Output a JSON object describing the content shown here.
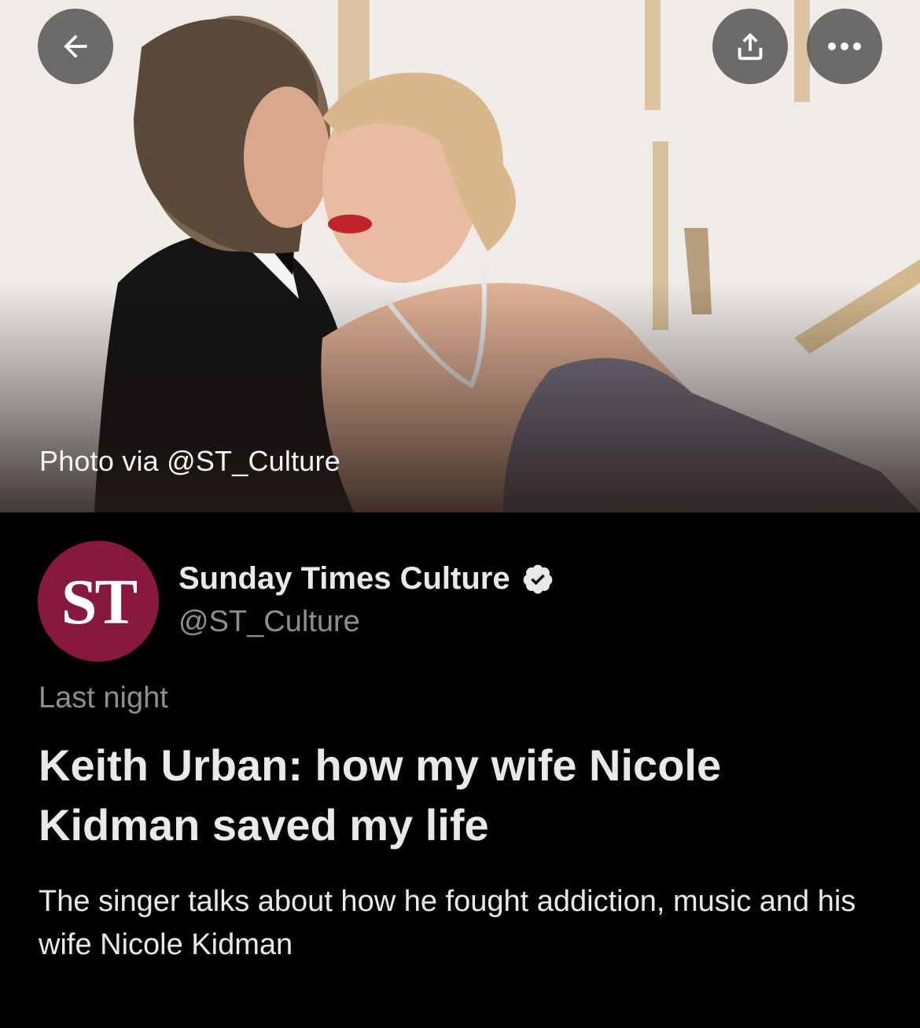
{
  "hero": {
    "image_alt": "Man in tuxedo and woman in strapless gown embracing",
    "photo_credit": "Photo via @ST_Culture"
  },
  "toolbar": {
    "back_icon": "arrow-left-icon",
    "share_icon": "share-upload-icon",
    "more_icon": "more-dots-icon"
  },
  "account": {
    "avatar_text": "ST",
    "avatar_color": "#87193f",
    "display_name": "Sunday Times Culture",
    "verified_icon": "verified-badge-icon",
    "handle": "@ST_Culture"
  },
  "article": {
    "timestamp": "Last night",
    "headline": "Keith Urban: how my wife Nicole Kidman saved my life",
    "description": "The singer talks about how he fought addiction, music and his wife Nicole Kidman"
  }
}
